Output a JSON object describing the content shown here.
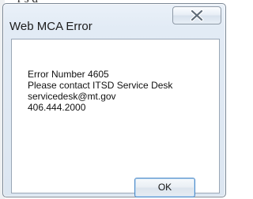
{
  "background": {
    "partial_text": "r    s   d   "
  },
  "dialog": {
    "title": "Web MCA Error",
    "close_icon": "close-x-icon",
    "message_lines": [
      "Error Number 4605",
      "Please contact ITSD Service Desk",
      "servicedesk@mt.gov",
      "406.444.2000"
    ],
    "ok_label": "OK"
  },
  "colors": {
    "frame": "#dce6f1",
    "border": "#7b8896",
    "ok_focus": "#4e8bc8"
  }
}
